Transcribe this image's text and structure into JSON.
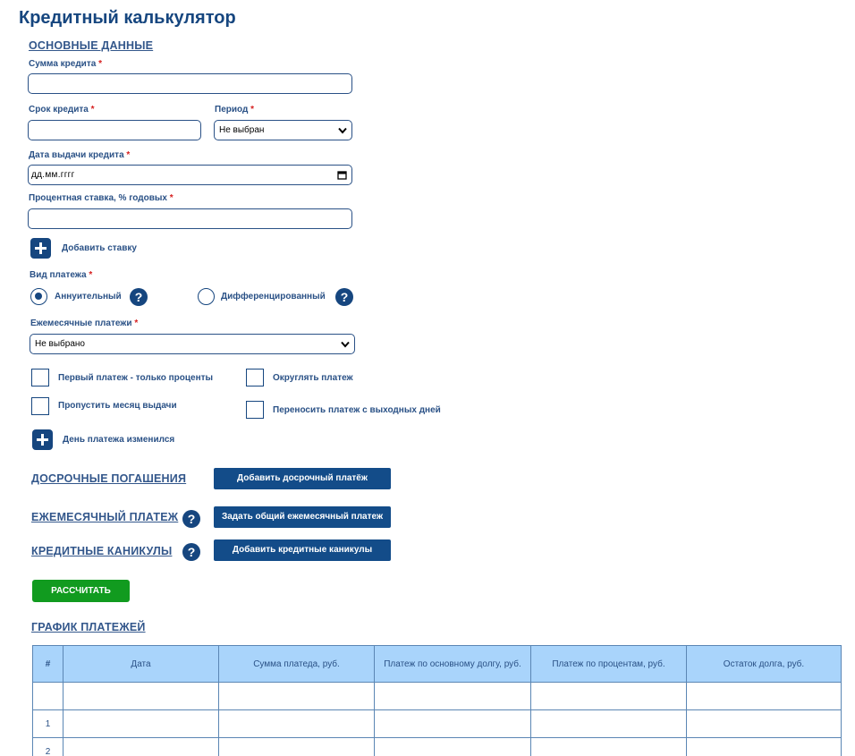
{
  "page": {
    "title": "Кредитный калькулятор"
  },
  "basic": {
    "heading": "ОСНОВНЫЕ ДАННЫЕ",
    "loan_amount_label": "Сумма кредита",
    "loan_term_label": "Срок кредита",
    "period_label": "Период",
    "period_value": "Не выбран",
    "issue_date_label": "Дата выдачи кредита",
    "issue_date_value": "дд.мм.гггг",
    "rate_label": "Процентная ставка, % годовых",
    "add_rate_label": "Добавить ставку",
    "required_mark": "*"
  },
  "payment_type": {
    "label": "Вид платежа",
    "annuity": "Аннуительный",
    "differentiated": "Дифференцированный",
    "selected": "annuity"
  },
  "monthly": {
    "label": "Ежемесячные платежи",
    "value": "Не выбрано"
  },
  "options": {
    "first_interest_only": "Первый платеж - только проценты",
    "round_payment": "Округлять платеж",
    "skip_issue_month": "Пропустить месяц выдачи",
    "move_weekend": "Переносить платеж с выходных дней"
  },
  "payment_day": {
    "label": "День платежа изменился"
  },
  "sections": {
    "early": {
      "heading": "ДОСРОЧНЫЕ ПОГАШЕНИЯ",
      "button": "Добавить досрочный платёж"
    },
    "monthly_payment": {
      "heading": "ЕЖЕМЕСЯЧНЫЙ ПЛАТЕЖ",
      "button": "Задать общий ежемесячный платеж"
    },
    "holidays": {
      "heading": "КРЕДИТНЫЕ КАНИКУЛЫ",
      "button": "Добавить кредитные каникулы"
    }
  },
  "calculate_label": "РАССЧИТАТЬ",
  "schedule": {
    "heading": "ГРАФИК ПЛАТЕЖЕЙ",
    "columns": [
      "#",
      "Дата",
      "Сумма платеда, руб.",
      "Платеж по основному долгу, руб.",
      "Платеж по процентам, руб.",
      "Остаток долга, руб."
    ],
    "rows": [
      [
        "",
        "",
        "",
        "",
        "",
        ""
      ],
      [
        "1",
        "",
        "",
        "",
        "",
        ""
      ],
      [
        "2",
        "",
        "",
        "",
        "",
        ""
      ]
    ]
  },
  "colors": {
    "brand": "#16467f",
    "button_blue": "#134c89",
    "button_green": "#119b1f",
    "table_header": "#a9d4fb",
    "required": "#d62020"
  },
  "icons": {
    "help": "question-mark",
    "add": "plus",
    "select": "chevron-down",
    "date": "calendar"
  }
}
